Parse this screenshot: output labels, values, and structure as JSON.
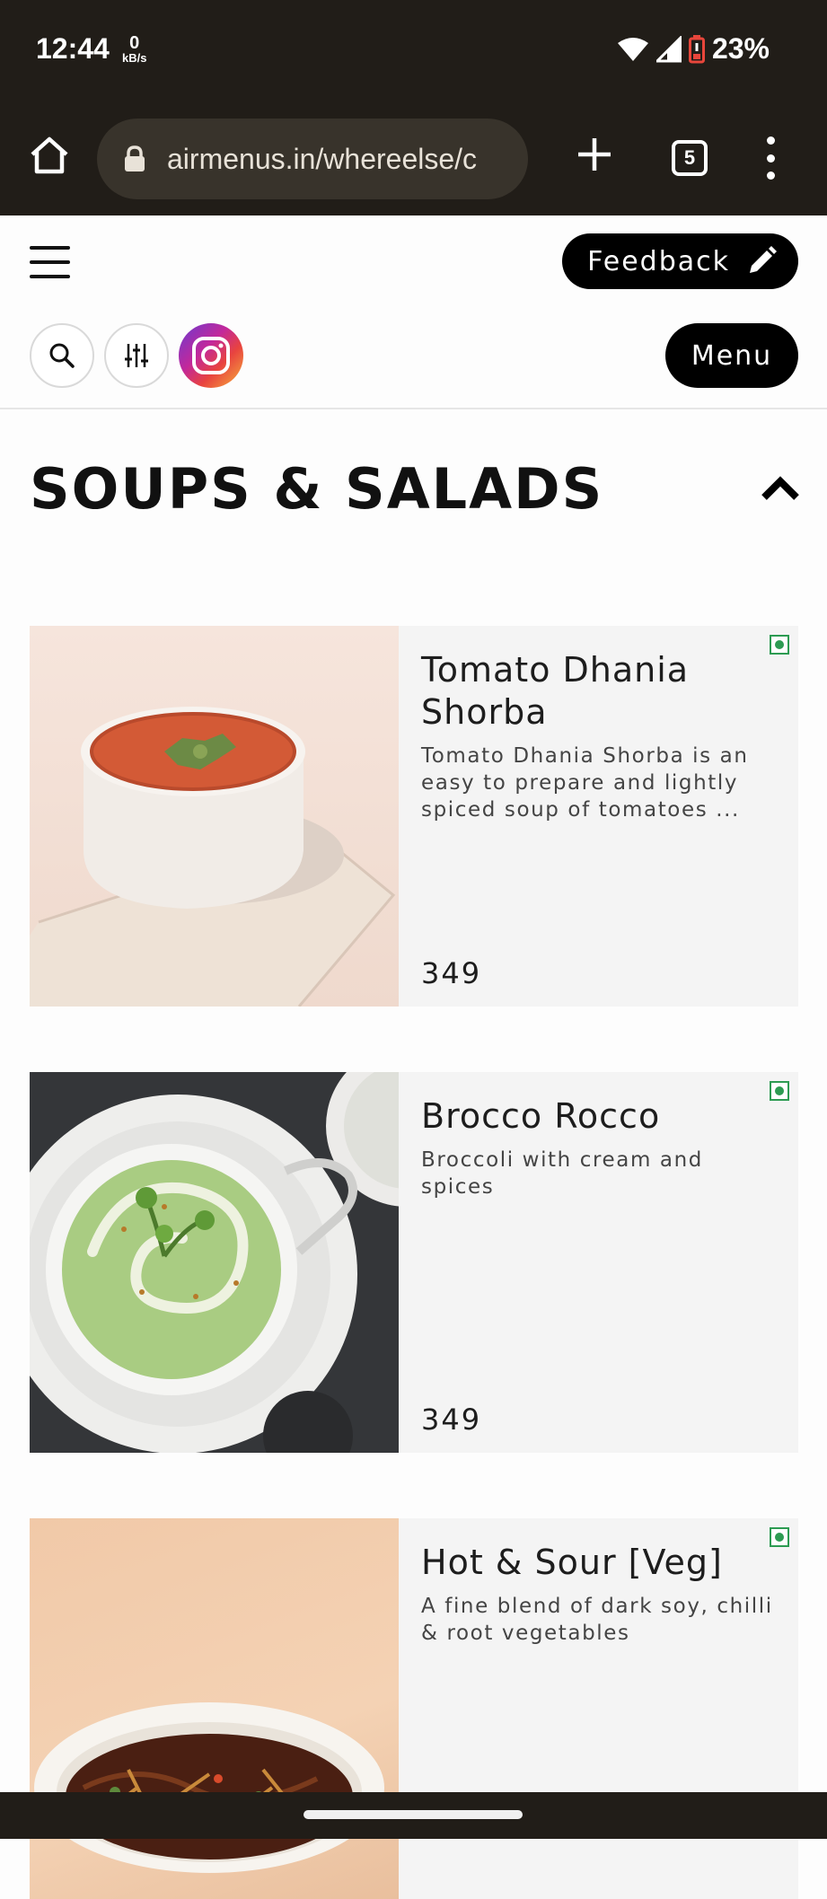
{
  "status_bar": {
    "time": "12:44",
    "data_rate_value": "0",
    "data_rate_unit": "kB/s",
    "battery_percent": "23%"
  },
  "browser": {
    "url": "airmenus.in/whereelse/c",
    "tab_count": "5"
  },
  "header": {
    "feedback_label": "Feedback",
    "menu_label": "Menu"
  },
  "section": {
    "title": "SOUPS & SALADS"
  },
  "items": [
    {
      "name": "Tomato Dhania Shorba",
      "description": "Tomato Dhania Shorba is an easy to prepare and lightly spiced soup of tomatoes ...",
      "price": "349",
      "veg": true
    },
    {
      "name": "Brocco Rocco",
      "description": "Broccoli with cream and spices",
      "price": "349",
      "veg": true
    },
    {
      "name": "Hot & Sour [Veg]",
      "description": "A fine blend of dark soy, chilli & root vegetables",
      "price": "",
      "veg": true
    }
  ],
  "colors": {
    "chrome_bg": "#211d18",
    "veg_green": "#2d9b52",
    "button_black": "#000000"
  }
}
